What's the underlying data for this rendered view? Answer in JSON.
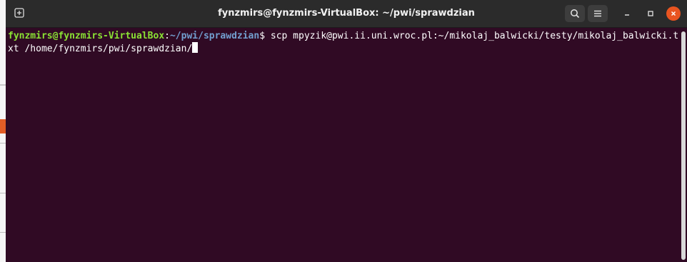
{
  "window": {
    "title": "fynzmirs@fynzmirs-VirtualBox: ~/pwi/sprawdzian"
  },
  "titlebar": {
    "new_tab_icon": "new-tab-icon",
    "search_icon": "search-icon",
    "menu_icon": "hamburger-menu-icon",
    "minimize_icon": "minimize-icon",
    "maximize_icon": "maximize-icon",
    "close_icon": "close-icon"
  },
  "terminal": {
    "prompt_user": "fynzmirs@fynzmirs-VirtualBox",
    "prompt_sep": ":",
    "prompt_path": "~/pwi/sprawdzian",
    "prompt_symbol": "$ ",
    "command": "scp mpyzik@pwi.ii.uni.wroc.pl:~/mikolaj_balwicki/testy/mikolaj_balwicki.txt /home/fynzmirs/pwi/sprawdzian/"
  },
  "colors": {
    "terminal_bg": "#300a24",
    "prompt_user": "#8ae234",
    "prompt_path": "#729fcf",
    "close_button": "#e95420",
    "titlebar_bg": "#2b2b2b"
  }
}
